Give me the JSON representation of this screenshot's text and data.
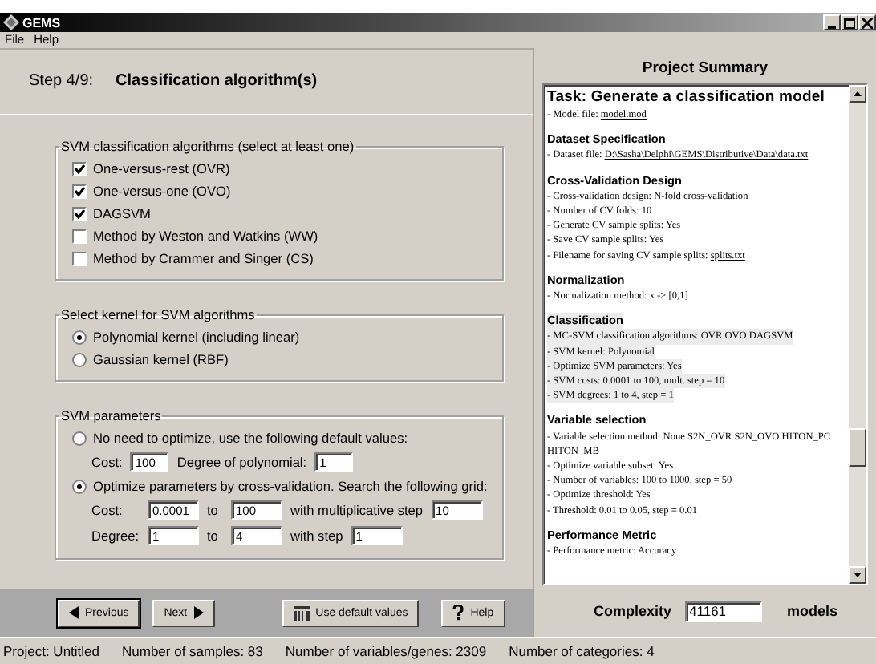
{
  "window": {
    "title": "GEMS"
  },
  "menu": [
    "File",
    "Help"
  ],
  "step": {
    "number": "Step 4/9:",
    "title": "Classification algorithm(s)"
  },
  "algorithms": {
    "legend": "SVM classification algorithms (select at least one)",
    "items": [
      {
        "label": "One-versus-rest (OVR)",
        "checked": true
      },
      {
        "label": "One-versus-one (OVO)",
        "checked": true
      },
      {
        "label": "DAGSVM",
        "checked": true
      },
      {
        "label": "Method by Weston and Watkins (WW)",
        "checked": false
      },
      {
        "label": "Method by Crammer and Singer (CS)",
        "checked": false
      }
    ]
  },
  "kernel": {
    "legend": "Select kernel for SVM algorithms",
    "options": [
      {
        "label": "Polynomial kernel (including linear)",
        "selected": true
      },
      {
        "label": "Gaussian kernel (RBF)",
        "selected": false
      }
    ]
  },
  "parameters": {
    "legend": "SVM parameters",
    "default_option": {
      "label": "No need to optimize, use the following default values:",
      "selected": false
    },
    "default_fields": [
      {
        "label": "Cost:",
        "value": "100"
      },
      {
        "label": "Degree of polynomial:",
        "value": "1"
      }
    ],
    "optimize_option": {
      "label": "Optimize parameters by cross-validation. Search the following grid:",
      "selected": true
    },
    "grid_rows": [
      {
        "label": "Cost:",
        "from": "0.0001",
        "to_label": "to",
        "to": "100",
        "step_label": "with multiplicative step",
        "step": "10"
      },
      {
        "label": "Degree:",
        "from": "1",
        "to_label": "to",
        "to": "4",
        "step_label": "with step",
        "step": "1"
      }
    ]
  },
  "buttons": [
    {
      "label": "Previous",
      "kind": "previous"
    },
    {
      "label": "Next",
      "kind": "next"
    },
    {
      "label": "Use default values",
      "kind": "defaults"
    },
    {
      "label": "Help",
      "kind": "help"
    }
  ],
  "summary": {
    "header": "Project Summary",
    "title": "Task: Generate a classification model",
    "intro": [
      {
        "text": "- Model file: ",
        "link": "model.mod"
      }
    ],
    "sections": [
      {
        "heading": "Dataset Specification",
        "highlighted": false,
        "lines": [
          {
            "text": "- Dataset file: ",
            "link": "D:\\Sasha\\Delphi\\GEMS\\Distributive\\Data\\data.txt"
          }
        ]
      },
      {
        "heading": "Cross-Validation Design",
        "highlighted": false,
        "lines": [
          {
            "text": "- Cross-validation design: N-fold cross-validation"
          },
          {
            "text": "- Number of CV folds: 10"
          },
          {
            "text": "- Generate CV sample splits: Yes"
          },
          {
            "text": "- Save CV sample splits: Yes"
          },
          {
            "text": "- Filename for saving CV sample splits: ",
            "link": "splits.txt"
          }
        ]
      },
      {
        "heading": "Normalization",
        "highlighted": false,
        "lines": [
          {
            "text": "- Normalization method: x -> [0,1]"
          }
        ]
      },
      {
        "heading": "Classification",
        "highlighted": true,
        "lines": [
          {
            "text": "- MC-SVM classification algorithms: OVR OVO DAGSVM"
          },
          {
            "text": "- SVM kernel: Polynomial"
          },
          {
            "text": "- Optimize SVM parameters: Yes"
          },
          {
            "text": "- SVM costs: 0.0001 to 100, mult. step = 10"
          },
          {
            "text": "- SVM degrees: 1 to 4, step = 1"
          }
        ]
      },
      {
        "heading": "Variable selection",
        "highlighted": false,
        "lines": [
          {
            "text": "- Variable selection method: None S2N_OVR S2N_OVO HITON_PC HITON_MB"
          },
          {
            "text": "- Optimize variable subset: Yes"
          },
          {
            "text": "- Number of variables: 100 to 1000, step = 50"
          },
          {
            "text": "- Optimize threshold: Yes"
          },
          {
            "text": "- Threshold: 0.01 to 0.05, step = 0.01"
          }
        ]
      },
      {
        "heading": "Performance Metric",
        "highlighted": false,
        "lines": [
          {
            "text": "- Performance metric: Accuracy"
          }
        ]
      }
    ],
    "complexity_label": "Complexity",
    "complexity": "41161",
    "complexity_unit": "models"
  },
  "status_bar": [
    "Project: Untitled",
    "Number of samples: 83",
    "Number of variables/genes: 2309",
    "Number of categories: 4"
  ]
}
